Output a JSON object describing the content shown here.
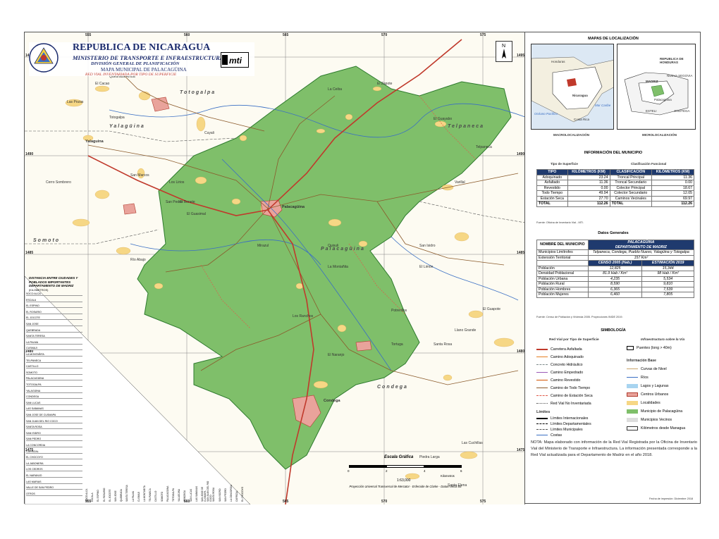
{
  "title": {
    "main": "REPUBLICA DE NICARAGUA",
    "ministry": "MINISTERIO DE TRANSPORTE E INFRAESTRUCTURA",
    "division": "DIVISIÓN GENERAL DE PLANIFICACIÓN",
    "map_name": "MAPA MUNICIPAL DE PALACAGÜINA",
    "subtitle": "RED VIAL INVENTARIADA POR TIPO DE SUPERFICIE",
    "logo_text": "mti"
  },
  "coords": {
    "top": [
      "555",
      "560",
      "565",
      "570",
      "575"
    ],
    "side": [
      "1495",
      "1490",
      "1485",
      "1480",
      "1475"
    ]
  },
  "places": {
    "regions": [
      "Totogalpa",
      "Yalagüina",
      "Telpaneca",
      "Somoto",
      "Palacagüina",
      "Condega"
    ],
    "towns": [
      "Palacagüina",
      "Condega",
      "Yalaguina",
      "Totogalpa",
      "Telpaneca"
    ],
    "minor": [
      "El Cacao",
      "Las Pozas",
      "Quebrada Arriba",
      "La Ceiba",
      "El Zapote",
      "El Guayabo",
      "Cuyali",
      "Los Lirios",
      "Varillal",
      "Cerro Sombrero",
      "San Marcos",
      "Mirazul",
      "El Guasimal",
      "Río Abajo",
      "San Isidro",
      "Quisuli",
      "La Montañita",
      "El Limón",
      "San Pedro",
      "El Bonete",
      "Llano Grande",
      "Santa Rosa",
      "El Guapote",
      "Potrerillos",
      "Los Ranchos",
      "Tortuga",
      "El Naranjo",
      "Santa Elena",
      "Las Cuchillas",
      "Piedra Larga"
    ]
  },
  "distance_table": {
    "title": "DISTANCIA ENTRE CIUDADES Y POBLADOS IMPORTANTES DEPARTAMENTO DE MADRIZ",
    "unit": "(KILOMETROS)",
    "rows": [
      "SOCO ALCA",
      "ESCALA",
      "EL ESPINO",
      "EL ROSARIO",
      "EL JOCOTE",
      "SAN JOSE",
      "QUEBRADA",
      "SANTA TERESA",
      "LA PALMA",
      "CUSMAJI",
      "LA MONTAÑITA",
      "TELPANECA",
      "CASTILLO",
      "SOMOTO",
      "PALACAGÜINA",
      "TOTOGALPA",
      "YALAGÜINA",
      "CONDEGA",
      "SAN LUCAS",
      "LAS SABANAS",
      "SAN JOSE DE CUSMAPA",
      "SAN JUAN DEL RIO COCO",
      "SANTA ROSA",
      "SAN ISIDRO",
      "SAN PEDRO",
      "LA CONCORDIA",
      "CARRIZAL",
      "EL CHOCOYO",
      "LA JABONERA",
      "LOS CEDROS",
      "EL NARANJO",
      "LAS MARIAS",
      "VALLE DE SAN PEDRO",
      "OTROS"
    ]
  },
  "location_maps": {
    "title": "MAPAS DE LOCALIZACIÓN",
    "macro_label": "MACROLOCALIZACIÓN",
    "micro_label": "MICROLOCALIZACIÓN",
    "macro_names": [
      "Honduras",
      "Nicaragua",
      "Costa Rica",
      "Océano Pacífico",
      "Mar Caribe"
    ],
    "micro_names": [
      "REPUBLICA DE HONDURAS",
      "NUEVA SEGOVIA",
      "MADRIZ",
      "Palacagüina",
      "ESTELI",
      "JINOTEGA"
    ]
  },
  "info": {
    "title": "INFORMACIÓN DEL MUNICIPIO",
    "surface_title": "Tipo de Superficie",
    "class_title": "Clasificación Funcional",
    "surface_headers": [
      "TIPO",
      "KILÓMETROS (KM)"
    ],
    "class_headers": [
      "CLASIFICACIÓN",
      "KILÓMETROS (KM)"
    ],
    "surface_rows": [
      {
        "tipo": "Adoquinado",
        "km": "23.24"
      },
      {
        "tipo": "Asfaltado",
        "km": "11.36"
      },
      {
        "tipo": "Revestido",
        "km": "0.00"
      },
      {
        "tipo": "Todo Tiempo",
        "km": "49.94"
      },
      {
        "tipo": "Estación Seca",
        "km": "27.70"
      }
    ],
    "class_rows": [
      {
        "clase": "Troncal Principal",
        "km": "11.36"
      },
      {
        "clase": "Troncal Secundario",
        "km": "0.00"
      },
      {
        "clase": "Colector Principal",
        "km": "18.67"
      },
      {
        "clase": "Colector Secundario",
        "km": "12.05"
      },
      {
        "clase": "Caminos Vecinales",
        "km": "69.97"
      }
    ],
    "total_label": "TOTAL",
    "total_surface": "112.26",
    "total_class": "112.26",
    "source1": "Fuente: Oficina de Inventario Vial - MTI.",
    "general_title": "Datos Generales",
    "muni_header": "NOMBRE DEL MUNICIPIO",
    "muni_name": "PALACAGÜINA",
    "dept_name": "DEPARTAMENTO DE MADRIZ",
    "limitrophes_label": "Municipios Limítrofes",
    "limitrophes_value": "Telpaneca, Condega, Pueblo Nuevo, Yalagüina y Totogalpa",
    "extension_label": "Extensión Territorial",
    "extension_value": "157  Km²",
    "census_label": "CENSO 2005 (Hab.)",
    "estimate_label": "ESTIMACIÓN 2019",
    "demo_rows": [
      {
        "label": "Población",
        "c2005": "12,825",
        "e2019": "15,344"
      },
      {
        "label": "Densidad Poblacional",
        "c2005": "81.9 Hab / Km²",
        "e2019": "98 Hab / Km²"
      },
      {
        "label": "Población Urbana",
        "c2005": "4,235",
        "e2019": "5,534"
      },
      {
        "label": "Población Rural",
        "c2005": "8,590",
        "e2019": "9,810"
      },
      {
        "label": "Población Hombres",
        "c2005": "6,365",
        "e2019": "7,539"
      },
      {
        "label": "Población Mujeres",
        "c2005": "6,460",
        "e2019": "7,805"
      }
    ],
    "source2": "Fuente: Censo de Población y Vivienda 2005. Proyecciones INIDE 2019."
  },
  "legend": {
    "title": "SIMBOLOGÍA",
    "col1_title": "Red Vial por Tipo de Superficie",
    "col2_title": "Infraestructura sobre la Vía",
    "roads": [
      "Carretera Asfaltada",
      "Camino Adoquinado",
      "Concreto Hidráulico",
      "Camino Empedrado",
      "Camino Revestido",
      "Camino de Todo Tiempo",
      "Camino de Estación Seca",
      "Red Vial No Inventariada"
    ],
    "infra": [
      "Puentes (long > 40m)"
    ],
    "base_title": "Información Base",
    "base": [
      "Curvas de Nivel",
      "Ríos",
      "Lagos y Lagunas",
      "Centros Urbanos",
      "Localidades",
      "Municipio de Palacagüina",
      "Municipios Vecinos",
      "Kilómetros desde Managua"
    ],
    "limits_title": "Límites",
    "limits": [
      "Límites Internacionales",
      "Límites Departamentales",
      "Límites Municipales",
      "Costas"
    ]
  },
  "scale": {
    "title": "Escala Gráfica",
    "ticks": [
      "0",
      "2",
      "4",
      "6"
    ],
    "unit": "Kilometros",
    "ratio": "1:63,000",
    "projection": "Proyección Universal Transversal de Mercator - Esferoide de Clarke - Datum WGS 84"
  },
  "note": "NOTA: Mapa elaborado con información de la Red Vial Registrada por la Oficina de Inventario Vial del Ministerio de Transporte e Infraestructura. La información presentada corresponde a la Red Vial actualizada para el Departamento de Madriz en el año 2018.",
  "print_date": "Fecha de impresión: Diciembre 2018",
  "colors": {
    "municipality": "#7fbf6a",
    "neighbor": "#fdfbf2",
    "urban": "#e9a39b",
    "locality": "#f6d785",
    "road_paved": "#c0392b",
    "road_all_weather": "#8b5a2b",
    "river": "#3a6fc4",
    "header": "#1f3a6e"
  }
}
